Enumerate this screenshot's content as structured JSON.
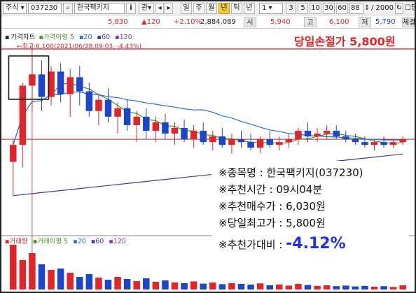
{
  "toolbar": {
    "market_select": "주식",
    "stock_code": "037230",
    "stock_name": "한국팩키지",
    "info_button": "i",
    "view_toggle": "관",
    "periods": [
      "일",
      "주",
      "월",
      "년",
      "틱",
      "년"
    ],
    "active_period": "년",
    "tick_value": "1",
    "minute_options": [
      "3",
      "5",
      "10",
      "30",
      "60"
    ],
    "count_value": "88",
    "count_max": "/ 2000",
    "single_option": "당일"
  },
  "quote": {
    "price": "5,830",
    "change": "▲120",
    "change_rate": "+2.10%",
    "volume": "2,884,089",
    "open_label": "시",
    "open": "5,940",
    "high_label": "고",
    "high": "6,100",
    "low_label": "저",
    "low": "5,790",
    "trailing_label": "체결"
  },
  "legend": {
    "price_chart": "가격차트",
    "ma_label": "가격이평 5",
    "ma_values": [
      "20",
      "60",
      "120"
    ]
  },
  "volume_legend": {
    "volume": "거래량",
    "ma_label": "거래이평 5",
    "ma_values": [
      "20",
      "60",
      "120"
    ]
  },
  "high_note": "←최고:6,100(2021/06/28,09:03, -4.43%)",
  "stop_note": "당일손절가 5,800원",
  "info": {
    "stock_line": "※종목명 : 한국팩키지(037230)",
    "time_line": "※추천시간 : 09시04분",
    "buy_line": "※추천매수가 : 6,030원",
    "high_line": "※당일최고가 : 5,800원",
    "ratio_label": "※추천가대비 :",
    "ratio_value": "-4.12%"
  },
  "colors": {
    "up": "#e0252b",
    "down": "#1d45c9",
    "ma5": "#3f9b2a",
    "ma20": "#2a6fd8",
    "ma60": "#3a3aa8",
    "ma120": "#8a3aa8",
    "stop_line": "#c8202a",
    "ratio": "#2030ee"
  },
  "chart_data": {
    "type": "candlestick",
    "stop_price": 5800,
    "candles": [
      {
        "o": 5720,
        "h": 5800,
        "l": 5600,
        "c": 5780
      },
      {
        "o": 5780,
        "h": 6000,
        "l": 5700,
        "c": 5990
      },
      {
        "o": 5990,
        "h": 6100,
        "l": 5900,
        "c": 6030
      },
      {
        "o": 6030,
        "h": 6080,
        "l": 5900,
        "c": 5950
      },
      {
        "o": 5950,
        "h": 6060,
        "l": 5920,
        "c": 6040
      },
      {
        "o": 6040,
        "h": 6070,
        "l": 5930,
        "c": 5960
      },
      {
        "o": 5960,
        "h": 6050,
        "l": 5880,
        "c": 6020
      },
      {
        "o": 6020,
        "h": 6060,
        "l": 5920,
        "c": 5970
      },
      {
        "o": 5970,
        "h": 6000,
        "l": 5880,
        "c": 5900
      },
      {
        "o": 5900,
        "h": 5960,
        "l": 5850,
        "c": 5940
      },
      {
        "o": 5940,
        "h": 5980,
        "l": 5860,
        "c": 5880
      },
      {
        "o": 5880,
        "h": 5930,
        "l": 5820,
        "c": 5910
      },
      {
        "o": 5910,
        "h": 5940,
        "l": 5830,
        "c": 5850
      },
      {
        "o": 5850,
        "h": 5900,
        "l": 5790,
        "c": 5880
      },
      {
        "o": 5880,
        "h": 5910,
        "l": 5800,
        "c": 5830
      },
      {
        "o": 5830,
        "h": 5880,
        "l": 5790,
        "c": 5860
      },
      {
        "o": 5860,
        "h": 5890,
        "l": 5800,
        "c": 5820
      },
      {
        "o": 5820,
        "h": 5860,
        "l": 5780,
        "c": 5840
      },
      {
        "o": 5840,
        "h": 5870,
        "l": 5790,
        "c": 5800
      },
      {
        "o": 5800,
        "h": 5850,
        "l": 5770,
        "c": 5830
      },
      {
        "o": 5830,
        "h": 5860,
        "l": 5780,
        "c": 5790
      },
      {
        "o": 5790,
        "h": 5830,
        "l": 5760,
        "c": 5810
      },
      {
        "o": 5810,
        "h": 5840,
        "l": 5770,
        "c": 5780
      },
      {
        "o": 5780,
        "h": 5820,
        "l": 5750,
        "c": 5800
      },
      {
        "o": 5800,
        "h": 5830,
        "l": 5770,
        "c": 5790
      },
      {
        "o": 5790,
        "h": 5820,
        "l": 5760,
        "c": 5770
      },
      {
        "o": 5770,
        "h": 5810,
        "l": 5750,
        "c": 5800
      },
      {
        "o": 5800,
        "h": 5830,
        "l": 5770,
        "c": 5780
      },
      {
        "o": 5780,
        "h": 5810,
        "l": 5760,
        "c": 5790
      },
      {
        "o": 5790,
        "h": 5820,
        "l": 5770,
        "c": 5800
      },
      {
        "o": 5800,
        "h": 5840,
        "l": 5780,
        "c": 5830
      },
      {
        "o": 5830,
        "h": 5860,
        "l": 5790,
        "c": 5810
      },
      {
        "o": 5810,
        "h": 5840,
        "l": 5790,
        "c": 5820
      },
      {
        "o": 5820,
        "h": 5850,
        "l": 5800,
        "c": 5830
      },
      {
        "o": 5830,
        "h": 5850,
        "l": 5800,
        "c": 5810
      },
      {
        "o": 5810,
        "h": 5830,
        "l": 5790,
        "c": 5800
      },
      {
        "o": 5800,
        "h": 5820,
        "l": 5780,
        "c": 5790
      },
      {
        "o": 5790,
        "h": 5810,
        "l": 5770,
        "c": 5780
      },
      {
        "o": 5780,
        "h": 5800,
        "l": 5760,
        "c": 5790
      },
      {
        "o": 5790,
        "h": 5810,
        "l": 5770,
        "c": 5780
      },
      {
        "o": 5780,
        "h": 5800,
        "l": 5770,
        "c": 5790
      },
      {
        "o": 5790,
        "h": 5810,
        "l": 5780,
        "c": 5800
      }
    ],
    "volumes": [
      320,
      210,
      260,
      180,
      140,
      150,
      120,
      90,
      110,
      85,
      70,
      90,
      75,
      60,
      80,
      55,
      65,
      50,
      45,
      58,
      42,
      50,
      38,
      46,
      40,
      35,
      44,
      30,
      36,
      28,
      40,
      32,
      26,
      30,
      24,
      28,
      22,
      26,
      20,
      24,
      18,
      30
    ]
  }
}
